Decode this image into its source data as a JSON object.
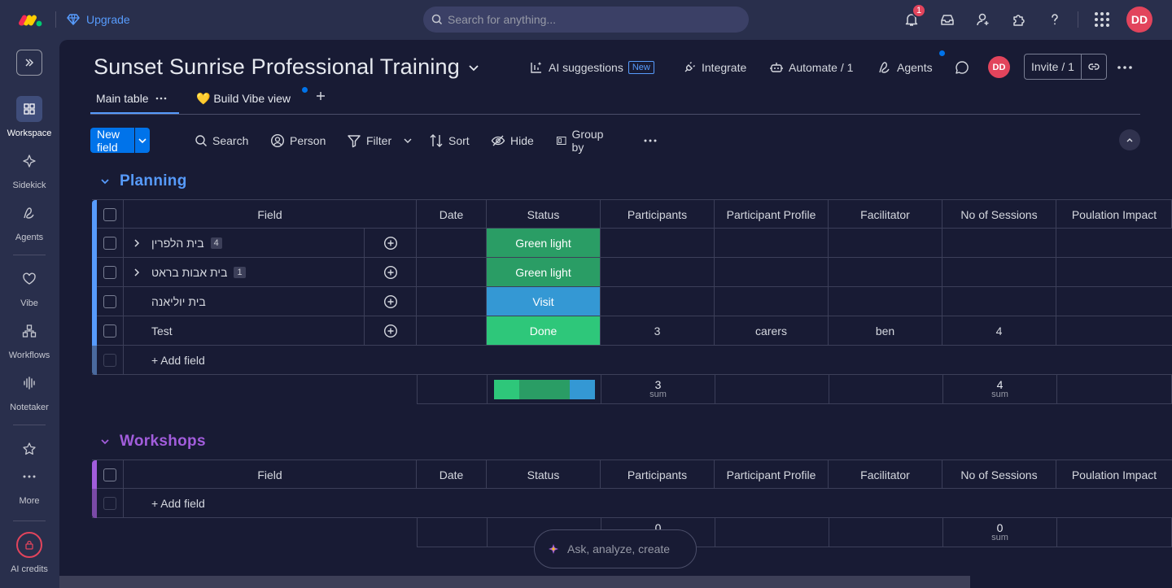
{
  "topbar": {
    "upgrade_label": "Upgrade",
    "search_placeholder": "Search for anything...",
    "notification_count": "1",
    "user_initials": "DD"
  },
  "sidebar": {
    "items": [
      {
        "label": "Workspace",
        "icon": "grid-icon",
        "active": true
      },
      {
        "label": "Sidekick",
        "icon": "sparkle-icon"
      },
      {
        "label": "Agents",
        "icon": "agents-icon"
      },
      {
        "label": "Vibe",
        "icon": "heart-icon"
      },
      {
        "label": "Workflows",
        "icon": "workflows-icon"
      },
      {
        "label": "Notetaker",
        "icon": "soundwave-icon"
      },
      {
        "label": "More",
        "icon": "star-icon"
      },
      {
        "label": "AI credits",
        "icon": "lock-icon"
      }
    ]
  },
  "board": {
    "title": "Sunset Sunrise Professional Training",
    "ai_suggestions": "AI suggestions",
    "new_tag": "New",
    "integrate": "Integrate",
    "automate": "Automate / 1",
    "agents": "Agents",
    "invite": "Invite / 1",
    "user_initials": "DD"
  },
  "tabs": [
    {
      "label": "Main table"
    },
    {
      "label": "💛 Build Vibe view"
    }
  ],
  "toolbar": {
    "new_field": "New field",
    "search": "Search",
    "person": "Person",
    "filter": "Filter",
    "sort": "Sort",
    "hide": "Hide",
    "group_by": "Group by"
  },
  "columns": [
    "Field",
    "Date",
    "Status",
    "Participants",
    "Participant Profile",
    "Facilitator",
    "No of Sessions",
    "Poulation Impact"
  ],
  "groups": [
    {
      "title": "Planning",
      "color": "#579bfc",
      "rows": [
        {
          "name": "בית הלפרין",
          "count": "4",
          "expandable": true,
          "status": "Green light",
          "status_color": "#2a9d65",
          "participants": "",
          "profile": "",
          "facilitator": "",
          "sessions": ""
        },
        {
          "name": "בית אבות בראט",
          "count": "1",
          "expandable": true,
          "status": "Green light",
          "status_color": "#2a9d65",
          "participants": "",
          "profile": "",
          "facilitator": "",
          "sessions": ""
        },
        {
          "name": "בית יוליאנה",
          "count": "",
          "expandable": false,
          "status": "Visit",
          "status_color": "#3498d4",
          "participants": "",
          "profile": "",
          "facilitator": "",
          "sessions": ""
        },
        {
          "name": "Test",
          "count": "",
          "expandable": false,
          "status": "Done",
          "status_color": "#2ec77a",
          "participants": "3",
          "profile": "carers",
          "facilitator": "ben",
          "sessions": "4"
        }
      ],
      "add_label": "+ Add field",
      "summary": {
        "participants": "3",
        "sessions": "4",
        "sum_label": "sum",
        "status_bar": [
          {
            "color": "#2ec77a",
            "fraction": 0.25
          },
          {
            "color": "#2a9d65",
            "fraction": 0.5
          },
          {
            "color": "#3498d4",
            "fraction": 0.25
          }
        ]
      }
    },
    {
      "title": "Workshops",
      "color": "#a25ddc",
      "rows": [],
      "add_label": "+ Add field",
      "summary": {
        "participants": "0",
        "sessions": "0",
        "sum_label": "sum"
      }
    }
  ],
  "ask": {
    "placeholder": "Ask, analyze, create"
  }
}
